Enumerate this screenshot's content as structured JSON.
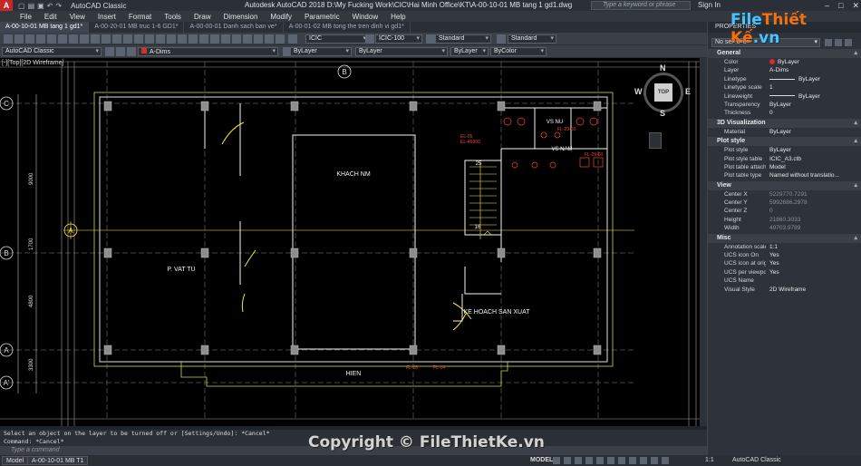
{
  "app": {
    "title": "Autodesk AutoCAD 2018    D:\\My Fucking Work\\CIC\\Hai Minh Office\\KT\\A-00-10-01 MB  tang 1 gd1.dwg",
    "workspace": "AutoCAD Classic",
    "search_placeholder": "Type a keyword or phrase",
    "sign_in": "Sign In"
  },
  "menu": [
    "File",
    "Edit",
    "View",
    "Insert",
    "Format",
    "Tools",
    "Draw",
    "Dimension",
    "Modify",
    "Parametric",
    "Window",
    "Help"
  ],
  "tabs": [
    {
      "label": "A-00-10-01 MB  tang 1 gd1*",
      "active": true
    },
    {
      "label": "A-00-20-01 MB truc 1-6 GD1*",
      "active": false
    },
    {
      "label": "A-00-00-01 Danh sach ban ve*",
      "active": false
    },
    {
      "label": "A-00-01-02 MB tong the tren dinh vi gd1*",
      "active": false
    }
  ],
  "toolbar1": {
    "text_style": "ICIC",
    "dim_style": "ICIC-100",
    "table_style": "Standard",
    "mleader_style": "Standard"
  },
  "toolbar2": {
    "workspace": "AutoCAD Classic",
    "layer": "A-Dims",
    "color": "ByLayer",
    "linetype": "ByLayer",
    "lineweight": "ByLayer",
    "plotstyle": "ByColor"
  },
  "viewport": {
    "label": "[-][Top][2D Wireframe]",
    "compass": {
      "n": "N",
      "s": "S",
      "e": "E",
      "w": "W",
      "top": "TOP"
    },
    "axes_left": [
      "C",
      "B",
      "A",
      "A'"
    ],
    "axis_top": "B",
    "axis_side": "A",
    "dims_left": [
      "9000",
      "1700",
      "4800",
      "3300"
    ],
    "rooms": [
      "KHACH NM",
      "P. VAT TU",
      "KE HOACH SAN XUAT",
      "HIEN",
      "VS NU",
      "VS NAM"
    ],
    "stair_labels": [
      "25",
      "16"
    ],
    "tags": [
      "EL-05",
      "EL-46800",
      "FL-29-60",
      "FL-29-60",
      "FL-28",
      "FL-14"
    ]
  },
  "properties": {
    "header": "PROPERTIES",
    "selection": "No selection",
    "sections": [
      {
        "name": "General",
        "rows": [
          {
            "k": "Color",
            "v": "ByLayer",
            "swatch": "#d32f2f"
          },
          {
            "k": "Layer",
            "v": "A-Dims"
          },
          {
            "k": "Linetype",
            "v": "ByLayer",
            "line": true
          },
          {
            "k": "Linetype scale",
            "v": "1"
          },
          {
            "k": "Lineweight",
            "v": "ByLayer",
            "line": true
          },
          {
            "k": "Transparency",
            "v": "ByLayer"
          },
          {
            "k": "Thickness",
            "v": "0"
          }
        ]
      },
      {
        "name": "3D Visualization",
        "rows": [
          {
            "k": "Material",
            "v": "ByLayer"
          }
        ]
      },
      {
        "name": "Plot style",
        "rows": [
          {
            "k": "Plot style",
            "v": "ByLayer"
          },
          {
            "k": "Plot style table",
            "v": "ICIC_A3.ctb"
          },
          {
            "k": "Plot table attached to",
            "v": "Model"
          },
          {
            "k": "Plot table type",
            "v": "Named without translatio..."
          }
        ]
      },
      {
        "name": "View",
        "rows": [
          {
            "k": "Center X",
            "v": "5229770.7291",
            "dim": true
          },
          {
            "k": "Center Y",
            "v": "5992686.2978",
            "dim": true
          },
          {
            "k": "Center Z",
            "v": "0",
            "dim": true
          },
          {
            "k": "Height",
            "v": "21860.3033",
            "dim": true
          },
          {
            "k": "Width",
            "v": "49703.9789",
            "dim": true
          }
        ]
      },
      {
        "name": "Misc",
        "rows": [
          {
            "k": "Annotation scale",
            "v": "1:1"
          },
          {
            "k": "UCS icon On",
            "v": "Yes"
          },
          {
            "k": "UCS icon at origin",
            "v": "Yes"
          },
          {
            "k": "UCS per viewport",
            "v": "Yes"
          },
          {
            "k": "UCS Name",
            "v": ""
          },
          {
            "k": "Visual Style",
            "v": "2D Wireframe"
          }
        ]
      }
    ]
  },
  "command": {
    "history_1": "Select an object on the layer to be turned off or [Settings/Undo]: *Cancel*",
    "history_2": "Command: *Cancel*",
    "placeholder": "Type a command"
  },
  "status": {
    "layout_tabs": [
      "Model",
      "A-00-10-01 MB T1"
    ],
    "mode": "MODEL",
    "scale": "1:1",
    "workspace": "AutoCAD Classic"
  },
  "watermark": "Copyright © FileThietKe.vn",
  "brand": {
    "part1": "File",
    "part2": "Thiết Kế",
    "part3": ".vn"
  }
}
